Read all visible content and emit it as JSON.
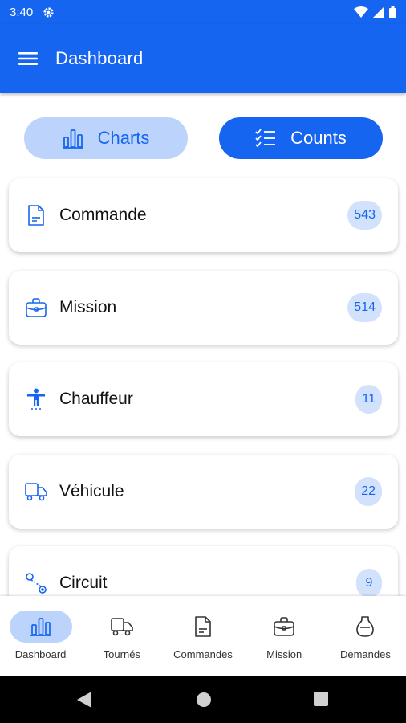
{
  "status_bar": {
    "time": "3:40"
  },
  "app_bar": {
    "title": "Dashboard"
  },
  "toggles": {
    "charts": "Charts",
    "counts": "Counts"
  },
  "cards": [
    {
      "label": "Commande",
      "count": "543",
      "icon": "document-icon"
    },
    {
      "label": "Mission",
      "count": "514",
      "icon": "briefcase-icon"
    },
    {
      "label": "Chauffeur",
      "count": "11",
      "icon": "person-icon"
    },
    {
      "label": "Véhicule",
      "count": "22",
      "icon": "truck-icon"
    },
    {
      "label": "Circuit",
      "count": "9",
      "icon": "route-icon"
    }
  ],
  "bottom_nav": [
    {
      "label": "Dashboard",
      "icon": "bar-chart-icon",
      "active": true
    },
    {
      "label": "Tournés",
      "icon": "truck-icon"
    },
    {
      "label": "Commandes",
      "icon": "document-icon"
    },
    {
      "label": "Mission",
      "icon": "briefcase-icon"
    },
    {
      "label": "Demandes",
      "icon": "flask-icon"
    }
  ],
  "colors": {
    "primary": "#1565f0",
    "chip_bg": "#bcd4fb",
    "badge_bg": "#d3e2fc"
  }
}
